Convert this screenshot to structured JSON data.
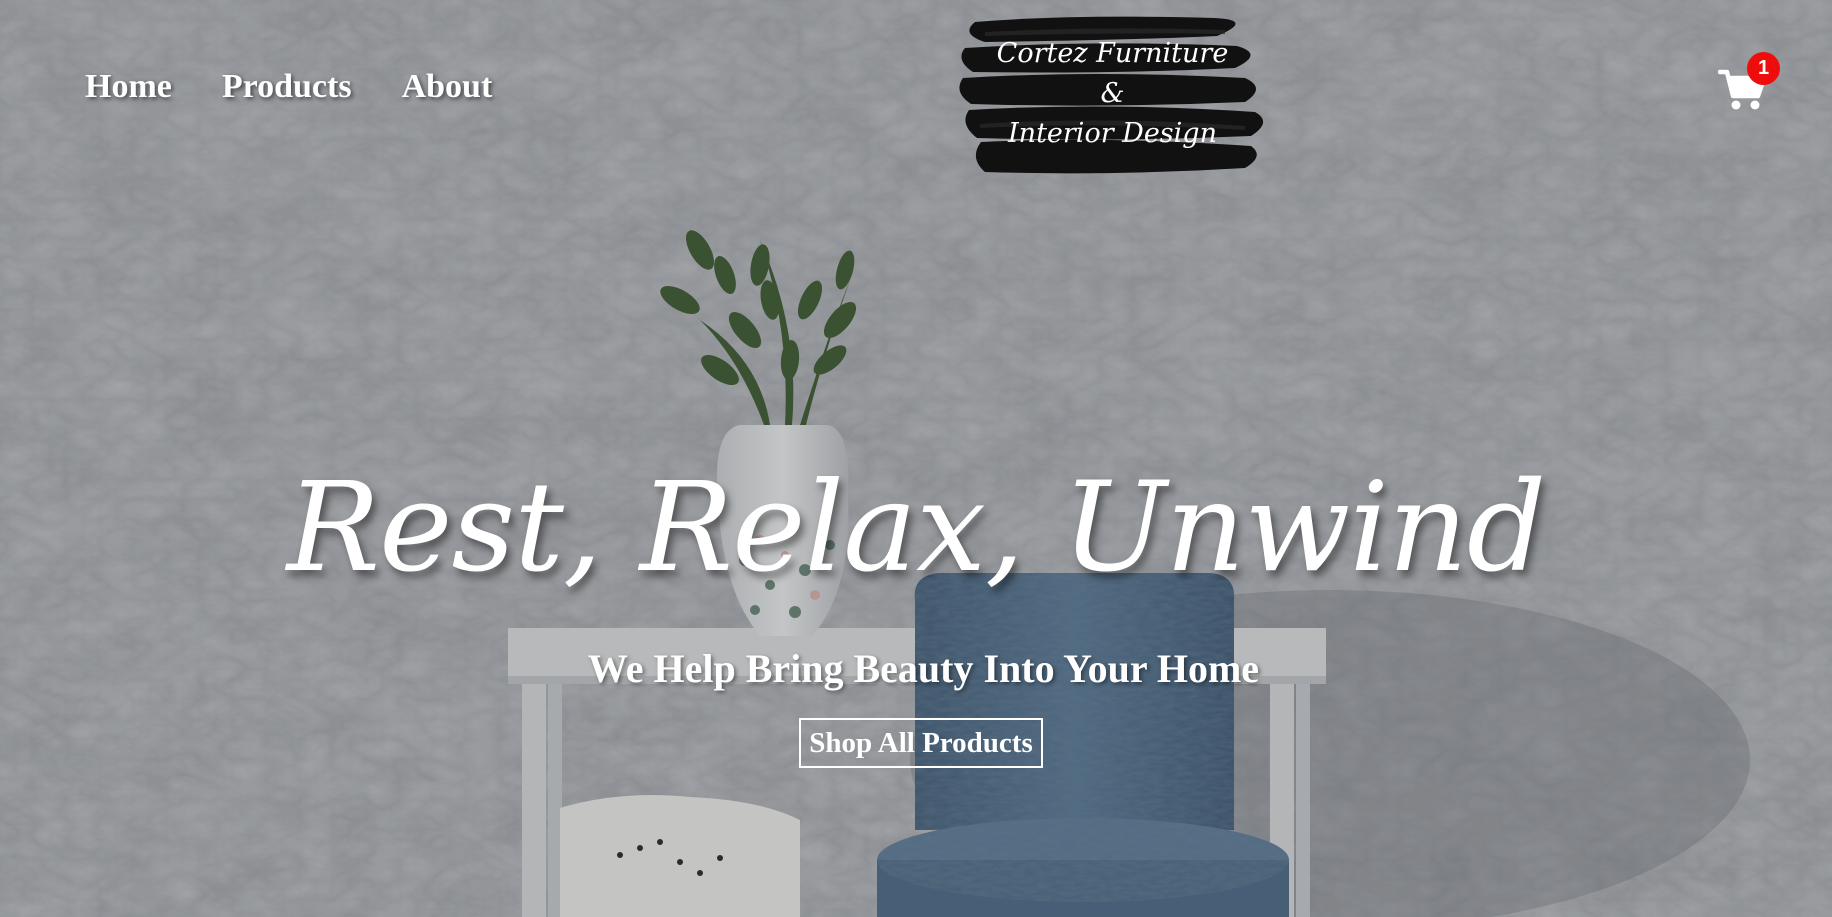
{
  "nav": {
    "items": [
      {
        "label": "Home"
      },
      {
        "label": "Products"
      },
      {
        "label": "About"
      }
    ]
  },
  "logo": {
    "line1": "Cortez Furniture",
    "line2": "&",
    "line3": "Interior Design"
  },
  "cart": {
    "icon": "shopping-cart-icon",
    "count": "1",
    "badge_color": "#ee0c0c"
  },
  "hero": {
    "headline": "Rest, Relax, Unwind",
    "subheadline": "We Help Bring Beauty Into Your Home",
    "cta_label": "Shop All Products"
  }
}
